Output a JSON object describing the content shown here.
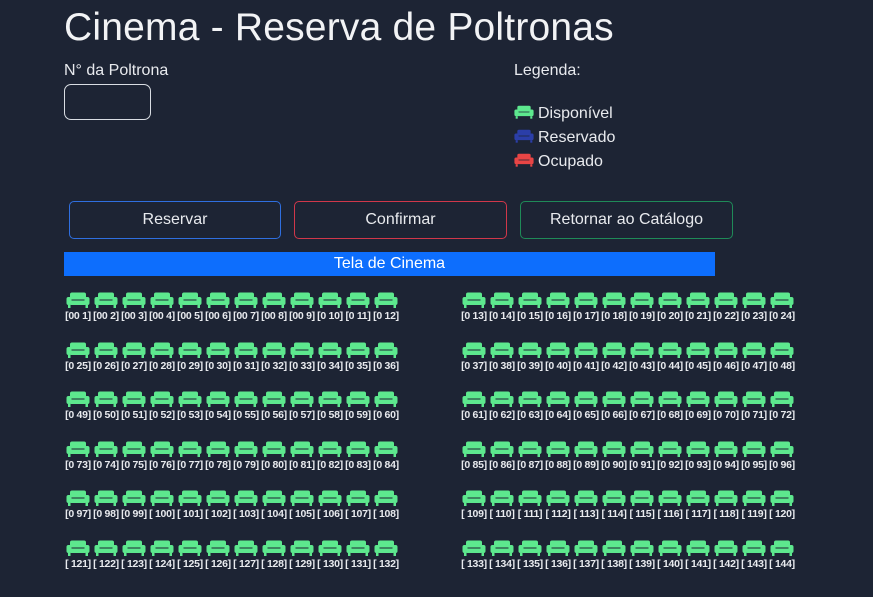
{
  "header": {
    "title": "Cinema - Reserva de Poltronas"
  },
  "form": {
    "seat_label": "N° da Poltrona",
    "seat_value": ""
  },
  "legend": {
    "title": "Legenda:",
    "items": [
      {
        "label": "Disponível",
        "color": "#5de88e"
      },
      {
        "label": "Reservado",
        "color": "#2b3ea8"
      },
      {
        "label": "Ocupado",
        "color": "#e84545"
      }
    ]
  },
  "buttons": {
    "reservar": "Reservar",
    "confirmar": "Confirmar",
    "retornar": "Retornar ao Catálogo"
  },
  "screen": {
    "label": "Tela de Cinema"
  },
  "seats": {
    "icon": "armchair-icon",
    "status": "Disponível",
    "rows": [
      {
        "left": [
          "[00 1]",
          "[00 2]",
          "[00 3]",
          "[00 4]",
          "[00 5]",
          "[00 6]",
          "[00 7]",
          "[00 8]",
          "[00 9]",
          "[0 10]",
          "[0 11]",
          "[0 12]"
        ],
        "right": [
          "[0 13]",
          "[0 14]",
          "[0 15]",
          "[0 16]",
          "[0 17]",
          "[0 18]",
          "[0 19]",
          "[0 20]",
          "[0 21]",
          "[0 22]",
          "[0 23]",
          "[0 24]"
        ]
      },
      {
        "left": [
          "[0 25]",
          "[0 26]",
          "[0 27]",
          "[0 28]",
          "[0 29]",
          "[0 30]",
          "[0 31]",
          "[0 32]",
          "[0 33]",
          "[0 34]",
          "[0 35]",
          "[0 36]"
        ],
        "right": [
          "[0 37]",
          "[0 38]",
          "[0 39]",
          "[0 40]",
          "[0 41]",
          "[0 42]",
          "[0 43]",
          "[0 44]",
          "[0 45]",
          "[0 46]",
          "[0 47]",
          "[0 48]"
        ]
      },
      {
        "left": [
          "[0 49]",
          "[0 50]",
          "[0 51]",
          "[0 52]",
          "[0 53]",
          "[0 54]",
          "[0 55]",
          "[0 56]",
          "[0 57]",
          "[0 58]",
          "[0 59]",
          "[0 60]"
        ],
        "right": [
          "[0 61]",
          "[0 62]",
          "[0 63]",
          "[0 64]",
          "[0 65]",
          "[0 66]",
          "[0 67]",
          "[0 68]",
          "[0 69]",
          "[0 70]",
          "[0 71]",
          "[0 72]"
        ]
      },
      {
        "left": [
          "[0 73]",
          "[0 74]",
          "[0 75]",
          "[0 76]",
          "[0 77]",
          "[0 78]",
          "[0 79]",
          "[0 80]",
          "[0 81]",
          "[0 82]",
          "[0 83]",
          "[0 84]"
        ],
        "right": [
          "[0 85]",
          "[0 86]",
          "[0 87]",
          "[0 88]",
          "[0 89]",
          "[0 90]",
          "[0 91]",
          "[0 92]",
          "[0 93]",
          "[0 94]",
          "[0 95]",
          "[0 96]"
        ]
      },
      {
        "left": [
          "[0 97]",
          "[0 98]",
          "[0 99]",
          "[ 100]",
          "[ 101]",
          "[ 102]",
          "[ 103]",
          "[ 104]",
          "[ 105]",
          "[ 106]",
          "[ 107]",
          "[ 108]"
        ],
        "right": [
          "[ 109]",
          "[ 110]",
          "[ 111]",
          "[ 112]",
          "[ 113]",
          "[ 114]",
          "[ 115]",
          "[ 116]",
          "[ 117]",
          "[ 118]",
          "[ 119]",
          "[ 120]"
        ]
      },
      {
        "left": [
          "[ 121]",
          "[ 122]",
          "[ 123]",
          "[ 124]",
          "[ 125]",
          "[ 126]",
          "[ 127]",
          "[ 128]",
          "[ 129]",
          "[ 130]",
          "[ 131]",
          "[ 132]"
        ],
        "right": [
          "[ 133]",
          "[ 134]",
          "[ 135]",
          "[ 136]",
          "[ 137]",
          "[ 138]",
          "[ 139]",
          "[ 140]",
          "[ 141]",
          "[ 142]",
          "[ 143]",
          "[ 144]"
        ]
      }
    ]
  }
}
